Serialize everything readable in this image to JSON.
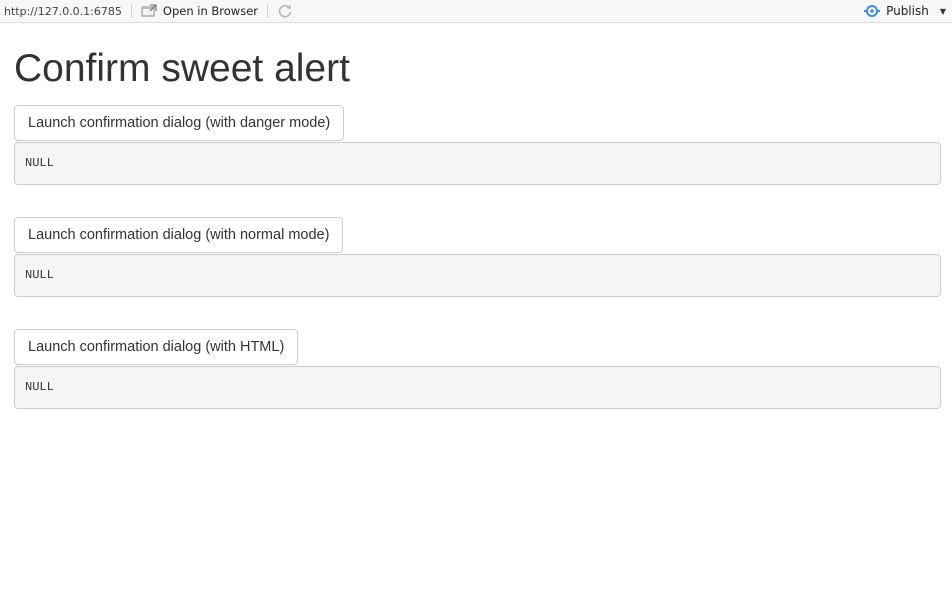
{
  "toolbar": {
    "url": "http://127.0.0.1:6785",
    "open_in_browser": "Open in Browser",
    "publish": "Publish"
  },
  "page": {
    "title": "Confirm sweet alert"
  },
  "blocks": [
    {
      "button_label": "Launch confirmation dialog (with danger mode)",
      "output": "NULL"
    },
    {
      "button_label": "Launch confirmation dialog (with normal mode)",
      "output": "NULL"
    },
    {
      "button_label": "Launch confirmation dialog (with HTML)",
      "output": "NULL"
    }
  ]
}
